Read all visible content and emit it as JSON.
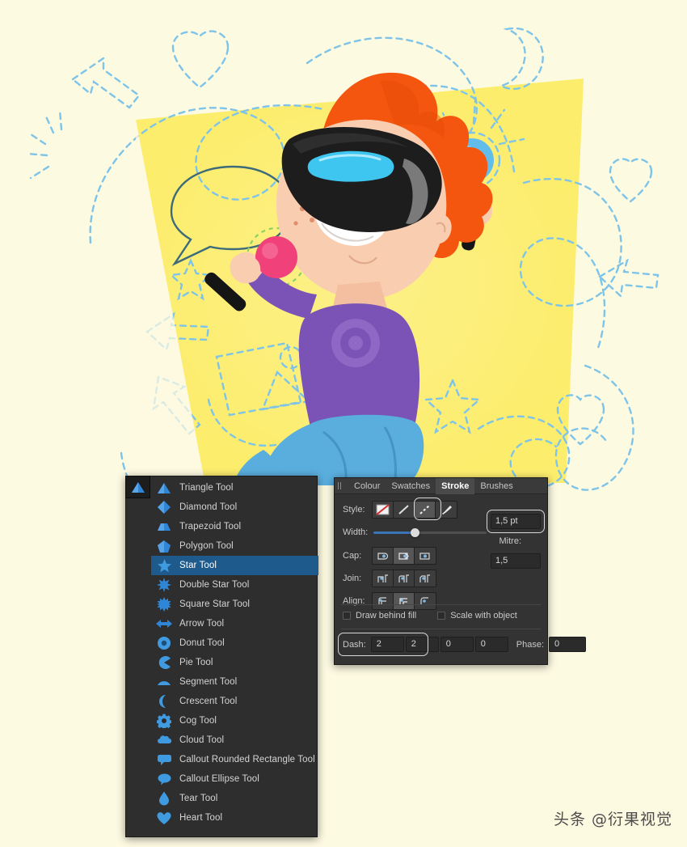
{
  "illustration": {
    "alt": "Boy with orange hair wearing VR headset holding maracas on yellow polygon background with blue dashed vector outlines",
    "colors": {
      "canvas_background": "#fdfae2",
      "yellow_shape": "#fced6d",
      "dash_stroke": "#7ec4e8",
      "hair": "#f4560f",
      "skin": "#f9cdb0",
      "shirt": "#7b52b5",
      "jeans": "#5aaede",
      "headset": "#1d1d1d",
      "headset_visor": "#3ec6f0",
      "maraca_pink": "#f0417a",
      "maraca_blue": "#63bdea"
    }
  },
  "tool_menu": {
    "badge_icon": "triangle-tool-icon",
    "selected": "Star Tool",
    "items": [
      {
        "label": "Triangle Tool",
        "icon": "triangle-icon"
      },
      {
        "label": "Diamond Tool",
        "icon": "diamond-icon"
      },
      {
        "label": "Trapezoid Tool",
        "icon": "trapezoid-icon"
      },
      {
        "label": "Polygon Tool",
        "icon": "pentagon-icon"
      },
      {
        "label": "Star Tool",
        "icon": "star-icon"
      },
      {
        "label": "Double Star Tool",
        "icon": "double-star-icon"
      },
      {
        "label": "Square Star Tool",
        "icon": "square-star-icon"
      },
      {
        "label": "Arrow Tool",
        "icon": "arrow-icon"
      },
      {
        "label": "Donut Tool",
        "icon": "donut-icon"
      },
      {
        "label": "Pie Tool",
        "icon": "pie-icon"
      },
      {
        "label": "Segment Tool",
        "icon": "segment-icon"
      },
      {
        "label": "Crescent Tool",
        "icon": "crescent-icon"
      },
      {
        "label": "Cog Tool",
        "icon": "cog-icon"
      },
      {
        "label": "Cloud Tool",
        "icon": "cloud-icon"
      },
      {
        "label": "Callout Rounded Rectangle Tool",
        "icon": "callout-rect-icon"
      },
      {
        "label": "Callout Ellipse Tool",
        "icon": "callout-ellipse-icon"
      },
      {
        "label": "Tear Tool",
        "icon": "tear-icon"
      },
      {
        "label": "Heart Tool",
        "icon": "heart-icon"
      }
    ]
  },
  "stroke_panel": {
    "tabs": [
      {
        "label": "Colour",
        "active": false
      },
      {
        "label": "Swatches",
        "active": false
      },
      {
        "label": "Stroke",
        "active": true
      },
      {
        "label": "Brushes",
        "active": false
      }
    ],
    "style": {
      "label": "Style:",
      "options": [
        "none-stroke-icon",
        "solid-line-icon",
        "dashed-line-icon",
        "brush-stroke-icon"
      ],
      "selected_index": 2
    },
    "width": {
      "label": "Width:",
      "value": "1,5 pt",
      "slider_percent": 38
    },
    "cap": {
      "label": "Cap:",
      "options": [
        "butt-cap-icon",
        "square-cap-icon",
        "round-cap-icon"
      ],
      "selected_index": 1
    },
    "join": {
      "label": "Join:",
      "options": [
        "miter-join-icon",
        "round-join-icon",
        "bevel-join-icon"
      ],
      "selected_index": -1
    },
    "align": {
      "label": "Align:",
      "options": [
        "align-center-icon",
        "align-inside-icon",
        "align-outside-icon"
      ],
      "selected_index": 1
    },
    "mitre": {
      "label": "Mitre:",
      "value": "1,5"
    },
    "checkboxes": [
      {
        "label": "Draw behind fill",
        "checked": false
      },
      {
        "label": "Scale with object",
        "checked": false
      }
    ],
    "dash": {
      "label": "Dash:",
      "values": [
        "2",
        "2",
        "0",
        "0"
      ]
    },
    "phase": {
      "label": "Phase:",
      "value": "0"
    }
  },
  "watermark": {
    "text": "头条 @衍果视觉"
  }
}
